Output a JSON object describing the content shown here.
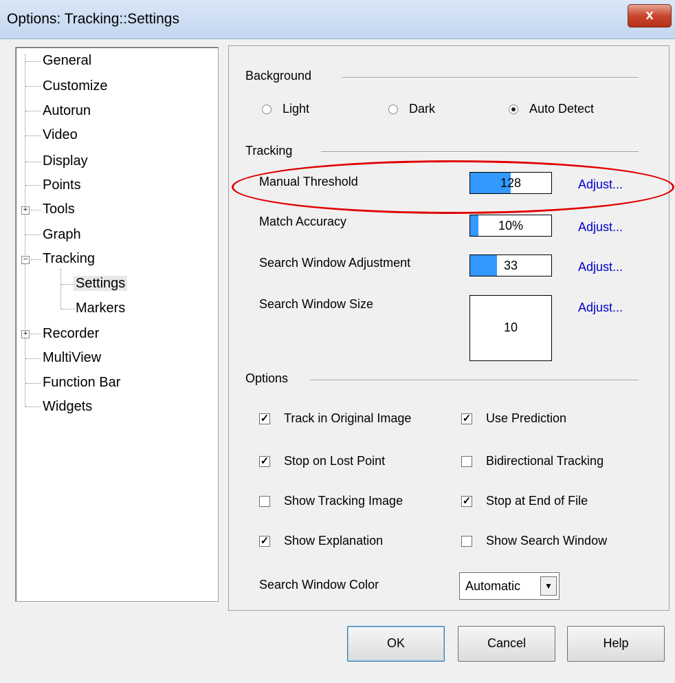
{
  "window": {
    "title": "Options: Tracking::Settings",
    "close_label": "x"
  },
  "tree": {
    "items": [
      {
        "label": "General"
      },
      {
        "label": "Customize"
      },
      {
        "label": "Autorun"
      },
      {
        "label": "Video"
      },
      {
        "label": "Display"
      },
      {
        "label": "Points"
      },
      {
        "label": "Tools",
        "expander": "+"
      },
      {
        "label": "Graph"
      },
      {
        "label": "Tracking",
        "expander": "−"
      },
      {
        "label": "Settings",
        "selected": true
      },
      {
        "label": "Markers"
      },
      {
        "label": "Recorder",
        "expander": "+"
      },
      {
        "label": "MultiView"
      },
      {
        "label": "Function Bar"
      },
      {
        "label": "Widgets"
      }
    ]
  },
  "background": {
    "title": "Background",
    "options": [
      {
        "label": "Light",
        "checked": false
      },
      {
        "label": "Dark",
        "checked": false
      },
      {
        "label": "Auto Detect",
        "checked": true
      }
    ]
  },
  "tracking": {
    "title": "Tracking",
    "manual_threshold": {
      "label": "Manual Threshold",
      "value": "128",
      "fill_fraction": 0.5,
      "adjust": "Adjust..."
    },
    "match_accuracy": {
      "label": "Match Accuracy",
      "value": "10%",
      "fill_fraction": 0.1,
      "adjust": "Adjust..."
    },
    "search_window_adjustment": {
      "label": "Search Window Adjustment",
      "value": "33",
      "fill_fraction": 0.33,
      "adjust": "Adjust..."
    },
    "search_window_size": {
      "label": "Search Window Size",
      "value": "10",
      "adjust": "Adjust..."
    }
  },
  "options": {
    "title": "Options",
    "checkboxes": [
      {
        "label": "Track in Original Image",
        "checked": true
      },
      {
        "label": "Use Prediction",
        "checked": true
      },
      {
        "label": "Stop on Lost Point",
        "checked": true
      },
      {
        "label": "Bidirectional Tracking",
        "checked": false
      },
      {
        "label": "Show Tracking Image",
        "checked": false
      },
      {
        "label": "Stop at End of File",
        "checked": true
      },
      {
        "label": "Show Explanation",
        "checked": true
      },
      {
        "label": "Show Search Window",
        "checked": false
      }
    ],
    "color_label": "Search Window Color",
    "color_value": "Automatic"
  },
  "buttons": {
    "ok": "OK",
    "cancel": "Cancel",
    "help": "Help"
  },
  "colors": {
    "accent": "#3399ff",
    "link": "#0000cc",
    "highlight": "#e00000"
  }
}
